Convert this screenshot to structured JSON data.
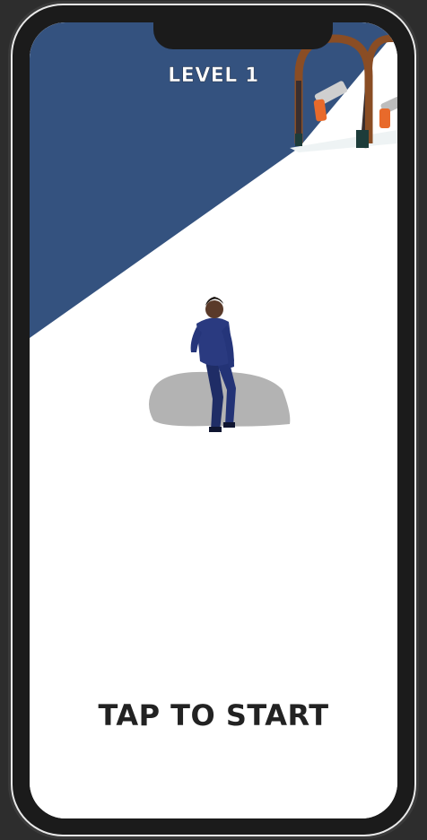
{
  "hud": {
    "level_label": "LEVEL 1"
  },
  "start_prompt": {
    "label": "TAP TO START"
  },
  "colors": {
    "sky": "#34527f",
    "ground": "#ffffff",
    "frame": "#1b1b1b",
    "gate": "#8a4d24",
    "gun_body": "#e86a2b",
    "player_outfit": "#1f2d66"
  },
  "icons": {
    "gun_1": "pistol-icon",
    "gun_2": "pistol-icon"
  }
}
